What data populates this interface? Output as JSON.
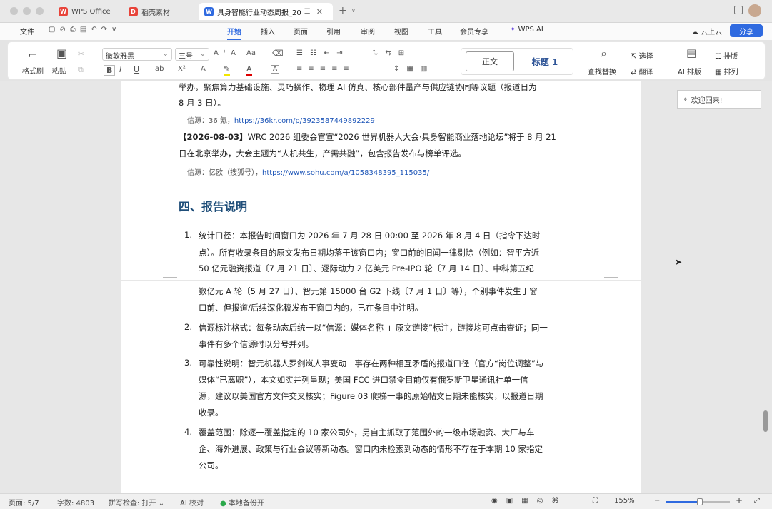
{
  "tabs": [
    {
      "label": "WPS Office",
      "icon": "wps-icon"
    },
    {
      "label": "稻壳素材",
      "icon": "docer-icon"
    },
    {
      "label": "具身智能行业动态周报_20",
      "icon": "word-doc-icon"
    }
  ],
  "menu": {
    "file": "文件",
    "items": [
      "开始",
      "插入",
      "页面",
      "引用",
      "审阅",
      "视图",
      "工具",
      "会员专享",
      "WPS AI"
    ],
    "active": "开始",
    "cloud": "云上云",
    "share": "分享"
  },
  "ribbon": {
    "format_painter": "格式刷",
    "paste": "粘贴",
    "font_name": "微软雅黑",
    "font_size": "三号",
    "style_normal": "正文",
    "style_h1": "标题 1",
    "find_replace": "查找替换",
    "select": "选择",
    "translate": "翻译",
    "ai_layout": "AI 排版",
    "layout": "排版",
    "arrange": "排列"
  },
  "nav_popup": "欢迎回来!",
  "document": {
    "top_line1": "举办，聚焦算力基础设施、灵巧操作、物理 AI 仿真、核心部件量产与供应链协同等议题（报道日为",
    "top_line2": "8 月 3 日）。",
    "src1_label": "信源：36 氪，",
    "src1_link": "https://36kr.com/p/3923587449892229",
    "entry_date": "【2026-08-03】",
    "entry_line1": "WRC 2026 组委会官宣“2026 世界机器人大会·具身智能商业落地论坛”将于 8 月 21",
    "entry_line2": "日在北京举办，大会主题为“人机共生，产需共融”，包含报告发布与榜单评选。",
    "src2_label": "信源：亿欧（搜狐号），",
    "src2_link": "https://www.sohu.com/a/1058348395_115035/",
    "section_title": "四、报告说明",
    "item1_num": "1.",
    "item1_l1": "统计口径：本报告时间窗口为 2026 年 7 月 28 日 00:00 至 2026 年 8 月 4 日（指令下达时",
    "item1_l2": "点）。所有收录条目的原文发布日期均落于该窗口内；窗口前的旧闻一律剔除（例如：智平方近",
    "item1_l3": "50 亿元融资报道〔7 月 21 日〕、逐际动力 2 亿美元 Pre-IPO 轮〔7 月 14 日〕、中科第五纪",
    "item1_l4": "数亿元 A 轮〔5 月 27 日〕、智元第 15000 台 G2 下线〔7 月 1 日〕等），个别事件发生于窗",
    "item1_l5": "口前、但报道/后续深化稿发布于窗口内的，已在条目中注明。",
    "item2_num": "2.",
    "item2_l1": "信源标注格式：每条动态后统一以“信源：媒体名称 + 原文链接”标注，链接均可点击查证；同一",
    "item2_l2": "事件有多个信源时以分号并列。",
    "item3_num": "3.",
    "item3_l1": "可靠性说明：智元机器人罗剑岚人事变动一事存在两种相互矛盾的报道口径（官方“岗位调整”与",
    "item3_l2": "媒体“已离职”），本文如实并列呈现；美国 FCC 进口禁令目前仅有俄罗斯卫星通讯社单一信",
    "item3_l3": "源，建议以美国官方文件交叉核实；Figure 03 爬梯一事的原始帖文日期未能核实，以报道日期",
    "item3_l4": "收录。",
    "item4_num": "4.",
    "item4_l1": "覆盖范围：除逐一覆盖指定的 10 家公司外，另自主抓取了范围外的一级市场融资、大厂与车",
    "item4_l2": "企、海外进展、政策与行业会议等新动态。窗口内未检索到动态的情形不存在于本期 10 家指定",
    "item4_l3": "公司。"
  },
  "status": {
    "page": "页面: 5/7",
    "words": "字数: 4803",
    "spell": "拼写检查: 打开",
    "ai_check": "AI 校对",
    "backup": "本地备份开",
    "zoom": "155%"
  }
}
